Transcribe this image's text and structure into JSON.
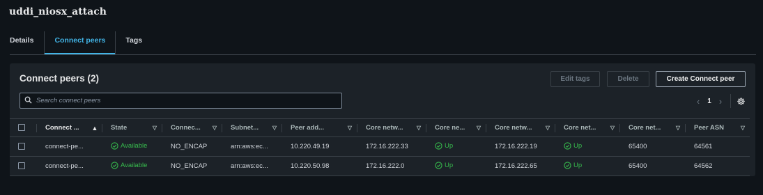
{
  "page": {
    "title": "uddi_niosx_attach"
  },
  "tabs": [
    {
      "label": "Details"
    },
    {
      "label": "Connect peers"
    },
    {
      "label": "Tags"
    }
  ],
  "panel": {
    "title": "Connect peers (2)",
    "buttons": {
      "edit_tags": "Edit tags",
      "delete": "Delete",
      "create": "Create Connect peer"
    },
    "search": {
      "placeholder": "Search connect peers"
    },
    "pagination": {
      "current_page": "1"
    }
  },
  "table": {
    "columns": [
      "Connect ...",
      "State",
      "Connec...",
      "Subnet...",
      "Peer add...",
      "Core netw...",
      "Core ne...",
      "Core netw...",
      "Core net...",
      "Core net...",
      "Peer ASN"
    ],
    "rows": [
      [
        "connect-pe...",
        "Available",
        "NO_ENCAP",
        "arn:aws:ec...",
        "10.220.49.19",
        "172.16.222.33",
        "Up",
        "172.16.222.19",
        "Up",
        "65400",
        "64561"
      ],
      [
        "connect-pe...",
        "Available",
        "NO_ENCAP",
        "arn:aws:ec...",
        "10.220.50.98",
        "172.16.222.0",
        "Up",
        "172.16.222.65",
        "Up",
        "65400",
        "64562"
      ]
    ]
  },
  "colors": {
    "accent": "#42b4e6",
    "success": "#37ba4d",
    "background": "#0f1419",
    "panel": "#1c2228"
  }
}
